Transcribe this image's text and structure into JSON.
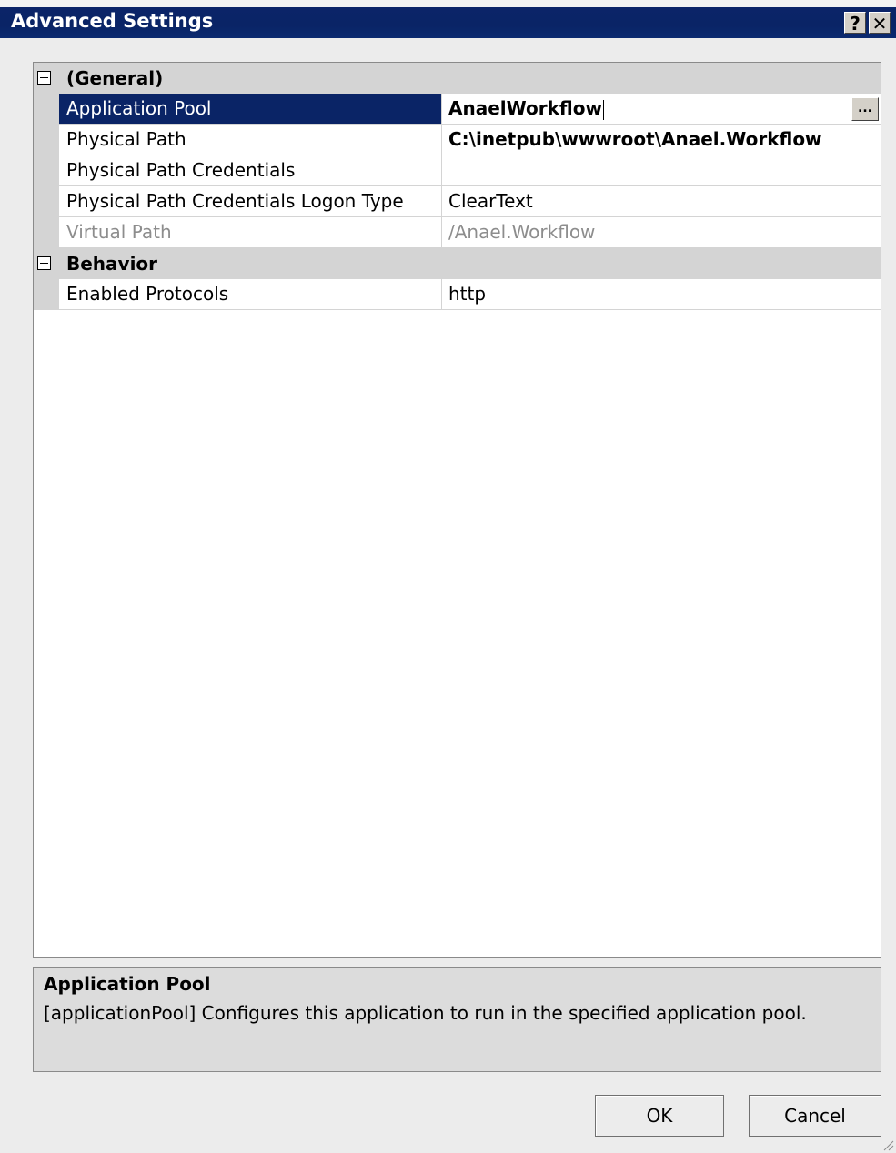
{
  "window": {
    "title": "Advanced Settings",
    "help_glyph": "?",
    "close_glyph": "✕"
  },
  "property_grid": {
    "categories": [
      {
        "label": "(General)",
        "expanded": true,
        "properties": [
          {
            "name": "Application Pool",
            "value": "AnaelWorkflow",
            "selected": true,
            "bold": true,
            "editing": true
          },
          {
            "name": "Physical Path",
            "value": "C:\\inetpub\\wwwroot\\Anael.Workflow",
            "bold": true
          },
          {
            "name": "Physical Path Credentials",
            "value": ""
          },
          {
            "name": "Physical Path Credentials Logon Type",
            "value": "ClearText"
          },
          {
            "name": "Virtual Path",
            "value": "/Anael.Workflow",
            "disabled": true
          }
        ]
      },
      {
        "label": "Behavior",
        "expanded": true,
        "properties": [
          {
            "name": "Enabled Protocols",
            "value": "http"
          }
        ]
      }
    ],
    "ellipsis_label": "..."
  },
  "description": {
    "title": "Application Pool",
    "text": "[applicationPool] Configures this application to run in the specified application pool."
  },
  "buttons": {
    "ok": "OK",
    "cancel": "Cancel"
  },
  "colors": {
    "titlebar": "#0a2466",
    "selection": "#0a2466",
    "category_bg": "#d4d4d4"
  }
}
